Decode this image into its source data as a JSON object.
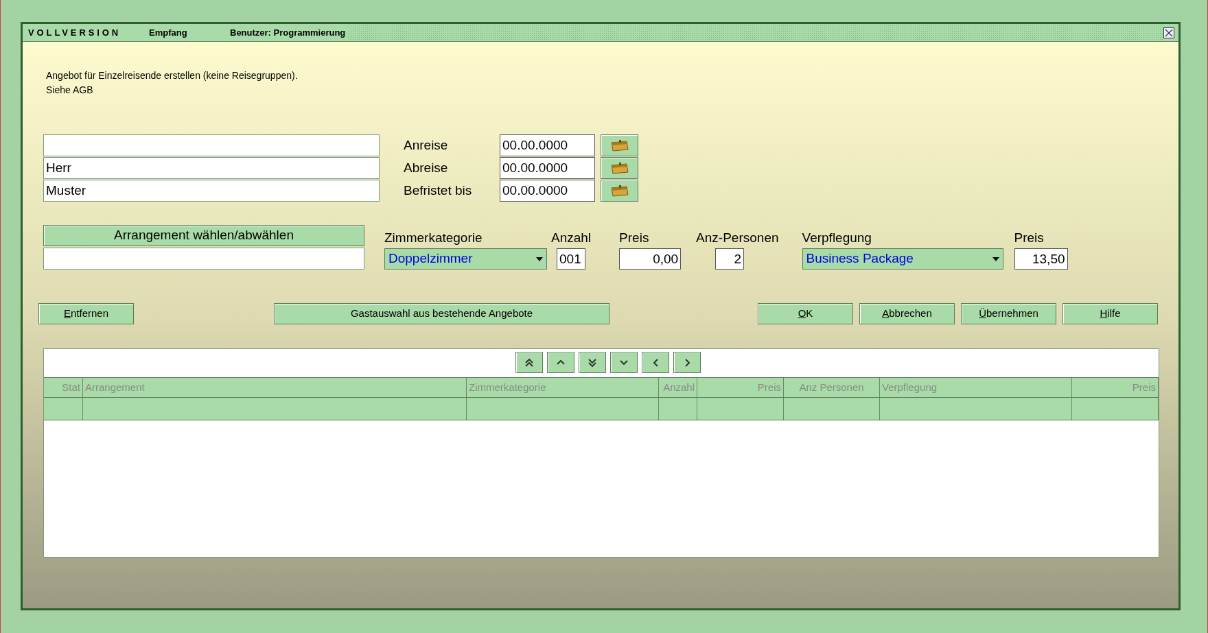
{
  "window": {
    "product": "VOLLVERSION",
    "section": "Empfang",
    "user": "Benutzer: Programmierung"
  },
  "description": [
    "Angebot für Einzelreisende erstellen (keine Reisegruppen).",
    "Siehe AGB"
  ],
  "guest_fields": [
    {
      "kind": "text"
    },
    {
      "kind": "text",
      "value": "Herr"
    },
    {
      "kind": "text",
      "value": "Muster"
    }
  ],
  "dates": [
    {
      "label": "Anreise",
      "value": "00.00.0000"
    },
    {
      "label": "Abreise",
      "value": "00.00.0000"
    },
    {
      "label": "Befristet bis",
      "value": "00.00.0000"
    }
  ],
  "arrangement_button": "Arrangement wählen/abwählen",
  "booking_fields": [
    {
      "kind": "select",
      "label": "Zimmerkategorie",
      "value": "Doppelzimmer"
    },
    {
      "kind": "input",
      "label": "Anzahl",
      "value": "001"
    },
    {
      "kind": "input",
      "label": "Preis",
      "value": "0,00"
    },
    {
      "kind": "input",
      "label": "Anz-Personen",
      "value": "2"
    },
    {
      "kind": "select",
      "label": "Verpflegung",
      "value": "Business Package"
    },
    {
      "kind": "input",
      "label": "Preis",
      "value": "13,50"
    }
  ],
  "left_buttons": [
    "Entfernen",
    "Gastauswahl aus bestehende Angebote"
  ],
  "right_buttons": [
    "OK",
    "Abbrechen",
    "Übernehmen",
    "Hilfe"
  ],
  "table": {
    "columns": [
      "Stat",
      "Arrangement",
      "Zimmerkategorie",
      "Anzahl",
      "Preis",
      "Anz Personen",
      "Verpflegung",
      "Preis"
    ]
  }
}
